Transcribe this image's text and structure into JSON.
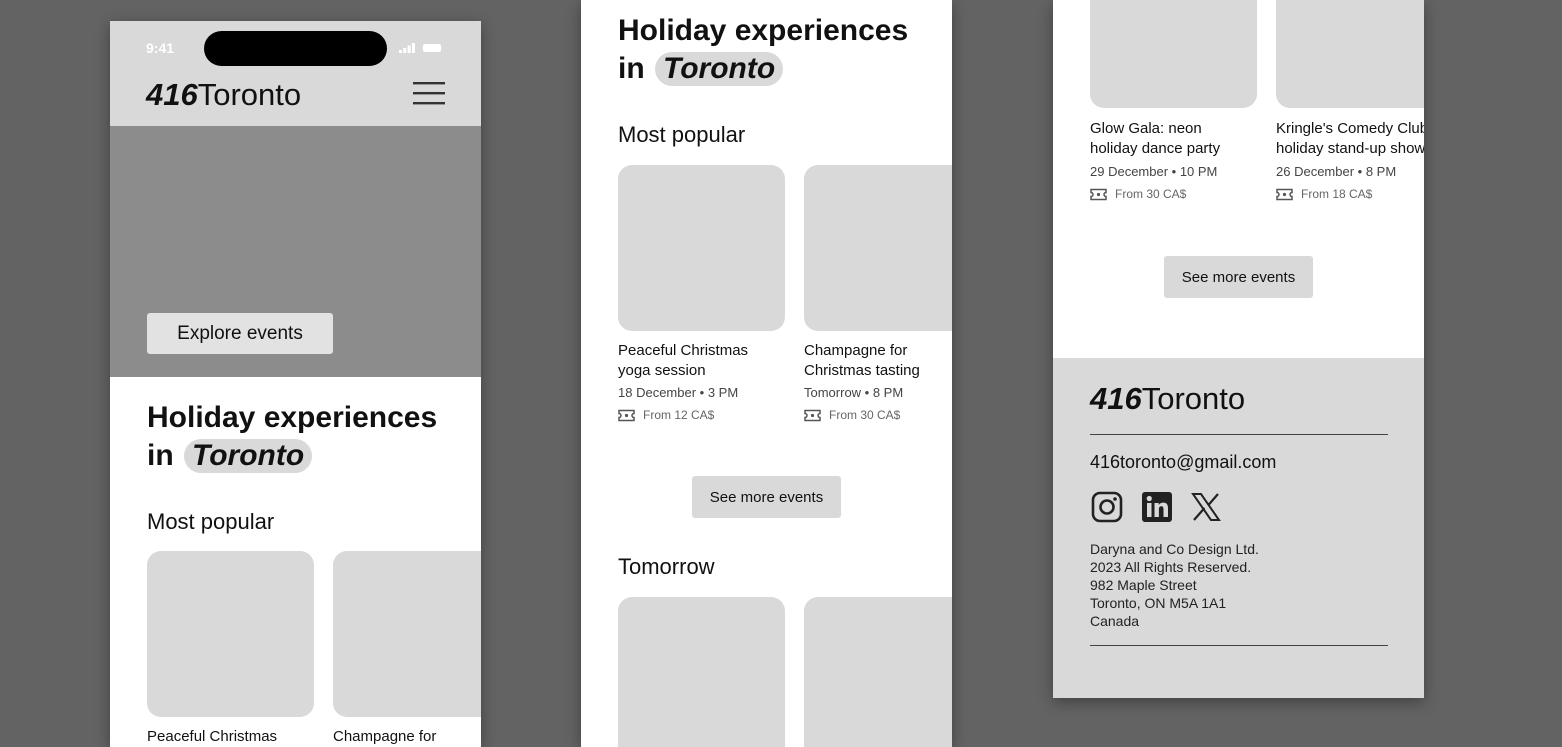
{
  "brand": {
    "number": "416",
    "name": "Toronto"
  },
  "status_bar": {
    "time": "9:41"
  },
  "hero": {
    "cta_label": "Explore events"
  },
  "headline": {
    "line1": "Holiday experiences",
    "line2_prefix": "in",
    "line2_highlight": "Toronto"
  },
  "sections": {
    "most_popular": "Most popular",
    "tomorrow": "Tomorrow"
  },
  "events": [
    {
      "title_line1": "Peaceful Christmas",
      "title_line2": "yoga session",
      "date": "18 December • 3 PM",
      "price": "From 12 CA$"
    },
    {
      "title_line1": "Champagne for",
      "title_line2": "Christmas tasting",
      "date": "Tomorrow • 8 PM",
      "price": "From 30 CA$"
    },
    {
      "title_line1": "Glow Gala: neon",
      "title_line2": "holiday dance party",
      "date": "29 December • 10 PM",
      "price": "From 30 CA$"
    },
    {
      "title_line1": "Kringle's Comedy Club",
      "title_line2": "holiday stand-up show",
      "date": "26 December • 8 PM",
      "price": "From 18 CA$"
    }
  ],
  "see_more_label": "See more events",
  "footer": {
    "email": "416toronto@gmail.com",
    "social": [
      "instagram-icon",
      "linkedin-icon",
      "x-icon"
    ],
    "legal": [
      "Daryna and Co Design Ltd.",
      "2023 All Rights Reserved.",
      "982 Maple Street",
      "Toronto, ON M5A 1A1",
      "Canada"
    ]
  }
}
